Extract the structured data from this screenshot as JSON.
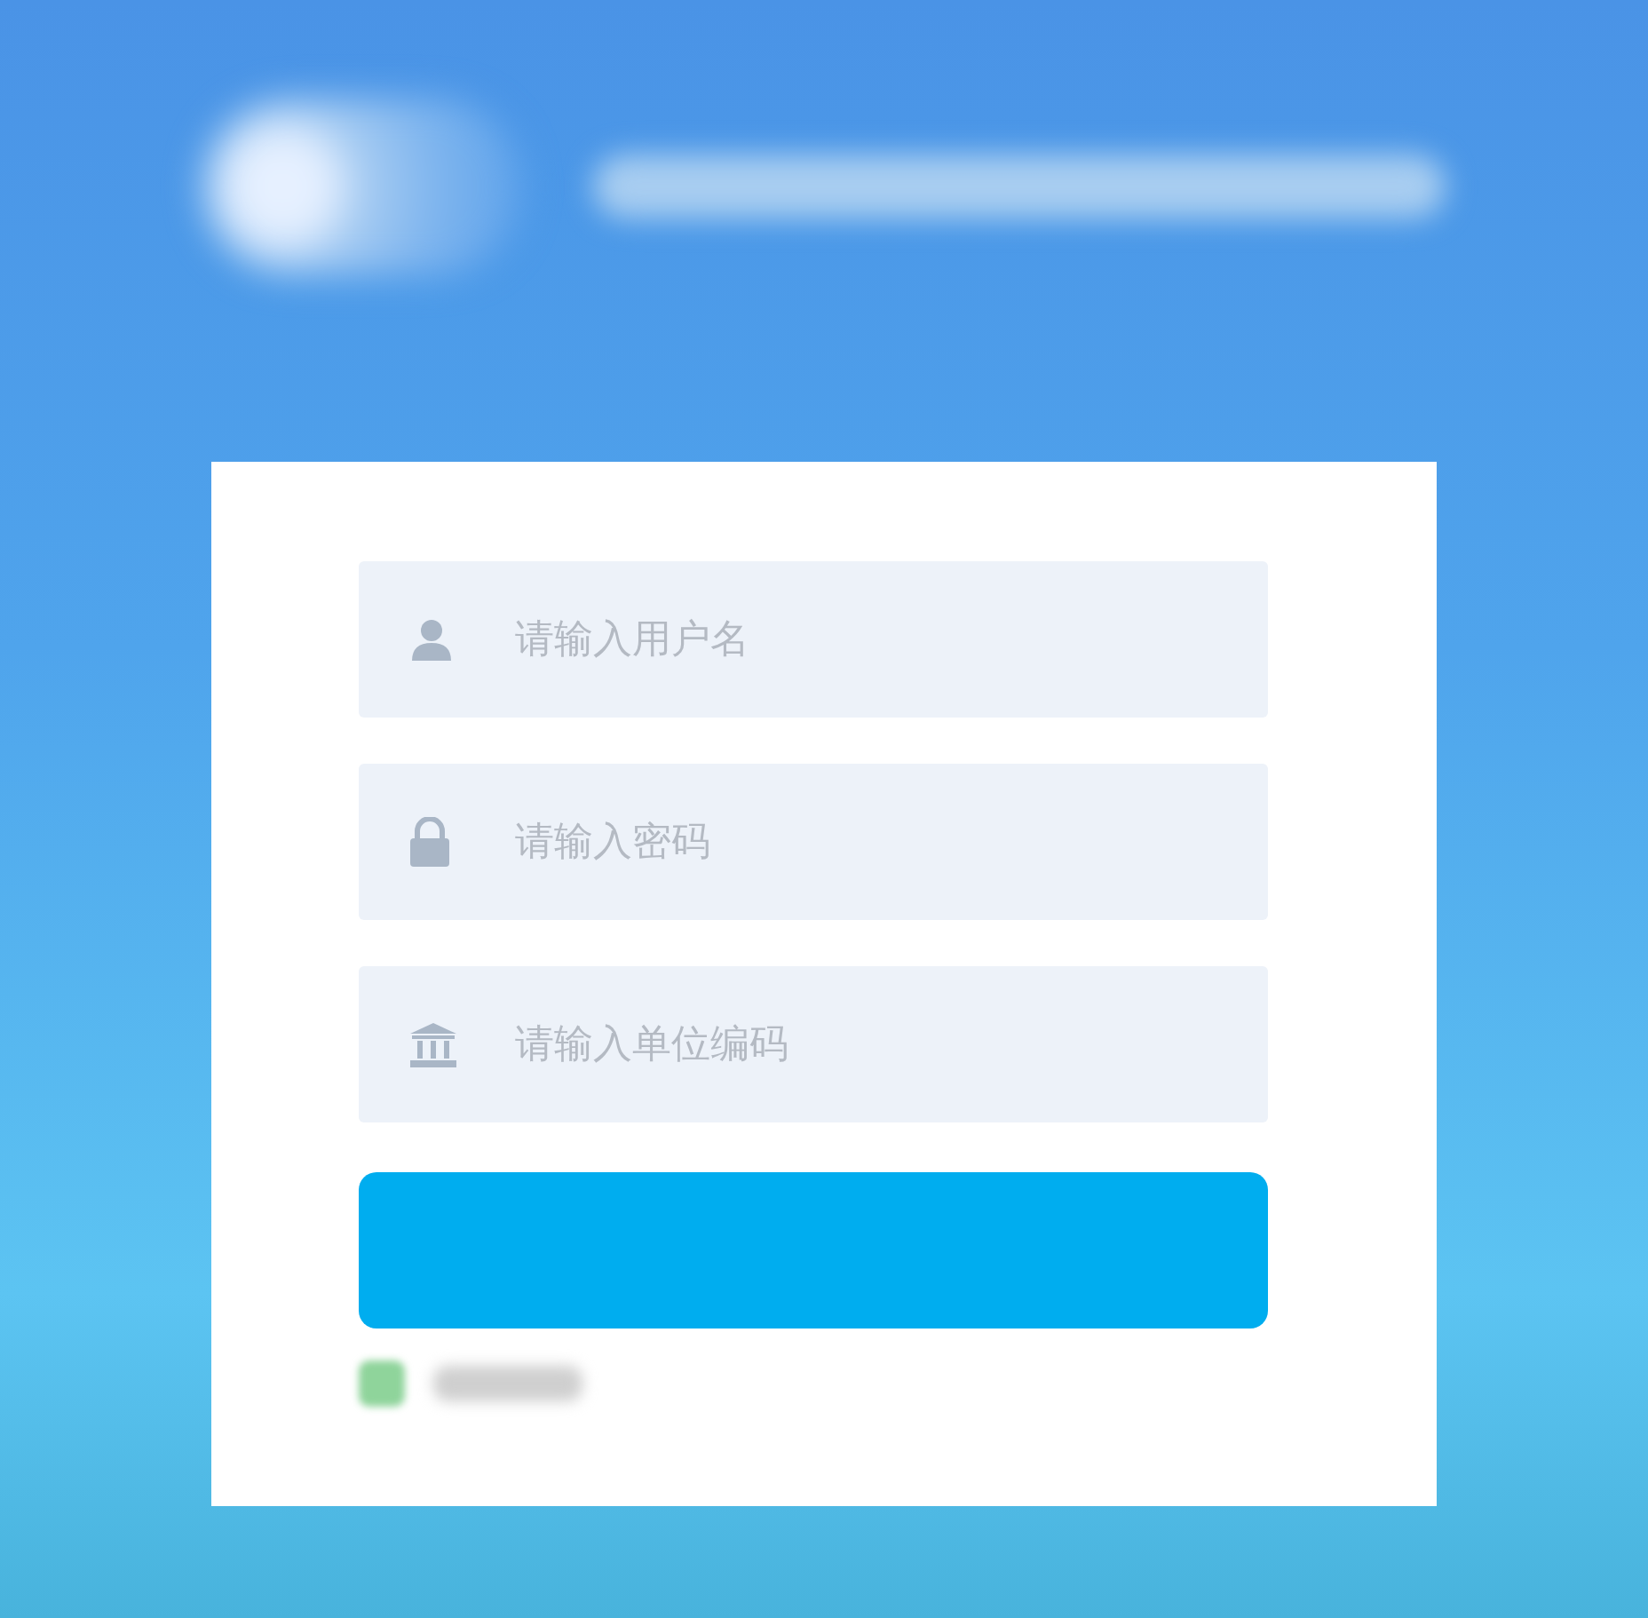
{
  "fields": [
    {
      "kind": "user",
      "placeholder": "请输入用户名"
    },
    {
      "kind": "password",
      "placeholder": "请输入密码"
    },
    {
      "kind": "organization",
      "placeholder": "请输入单位编码"
    }
  ],
  "remember": {
    "checked": true
  }
}
